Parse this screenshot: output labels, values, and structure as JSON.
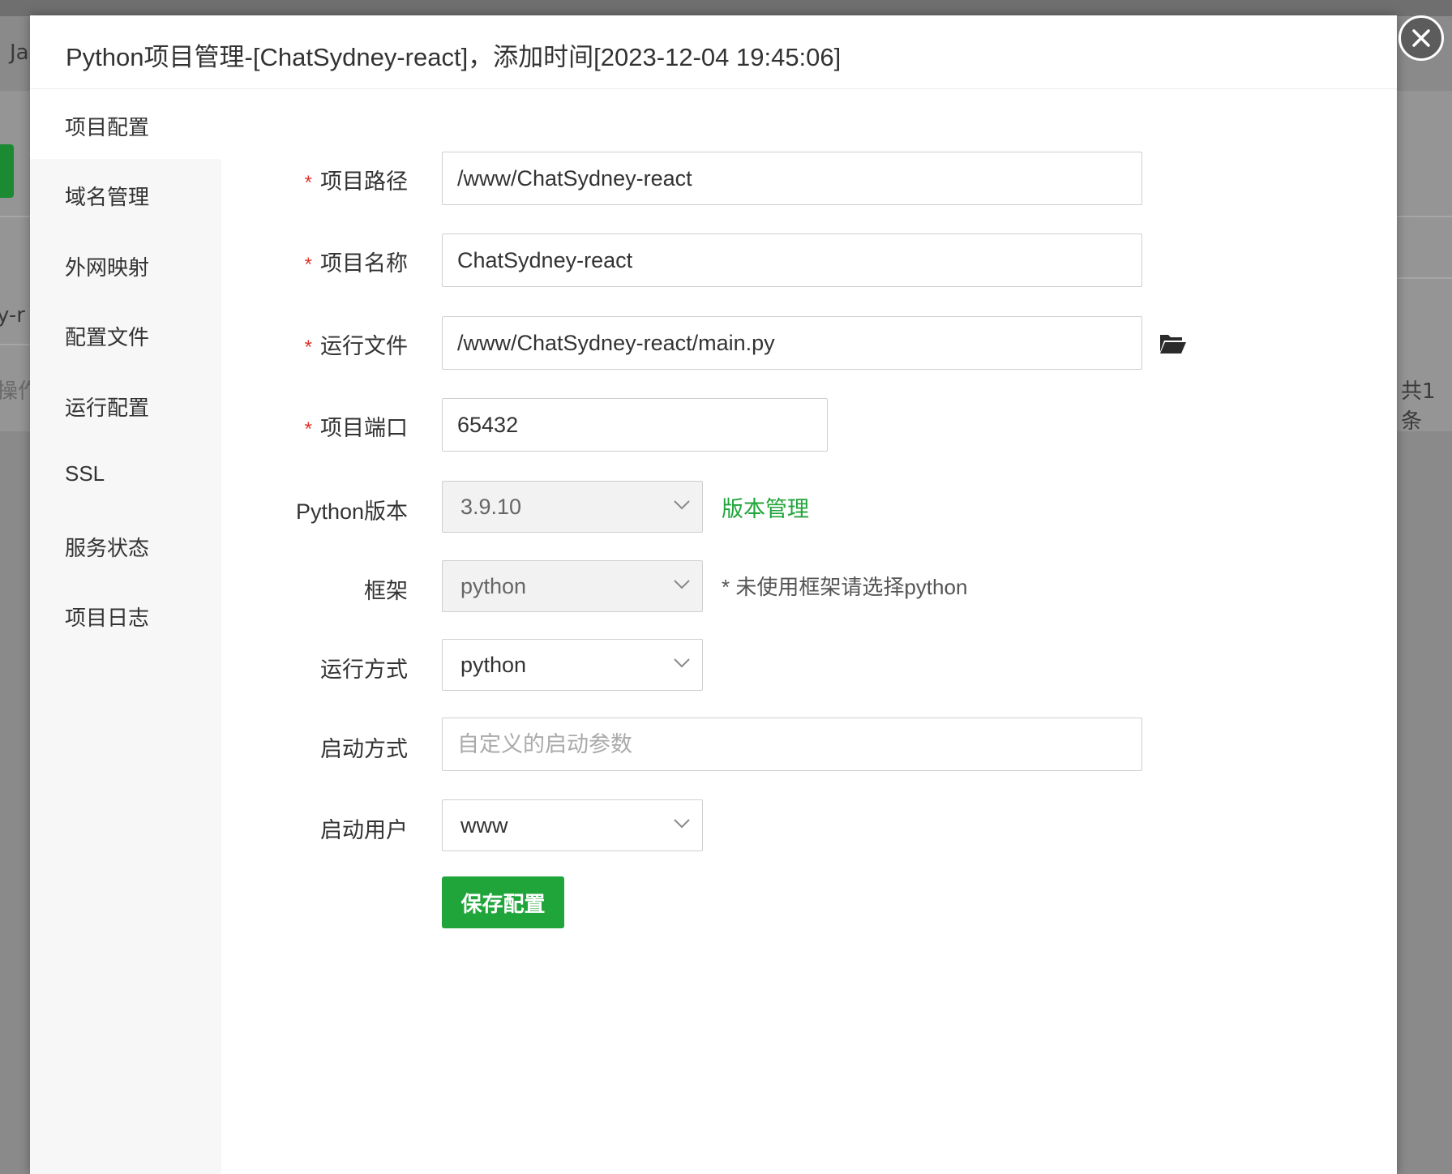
{
  "background": {
    "left_fragment_1": "Ja",
    "left_fragment_2": "y-r",
    "left_fragment_3": "操作",
    "right_fragment": "共1条"
  },
  "dialog": {
    "title": "Python项目管理-[ChatSydney-react]，添加时间[2023-12-04 19:45:06]",
    "close_icon": "close-icon"
  },
  "sidebar": {
    "items": [
      {
        "label": "项目配置"
      },
      {
        "label": "域名管理"
      },
      {
        "label": "外网映射"
      },
      {
        "label": "配置文件"
      },
      {
        "label": "运行配置"
      },
      {
        "label": "SSL"
      },
      {
        "label": "服务状态"
      },
      {
        "label": "项目日志"
      }
    ]
  },
  "form": {
    "required_mark": "*",
    "project_path": {
      "label": "项目路径",
      "value": "/www/ChatSydney-react"
    },
    "project_name": {
      "label": "项目名称",
      "value": "ChatSydney-react"
    },
    "run_file": {
      "label": "运行文件",
      "value": "/www/ChatSydney-react/main.py",
      "icon": "folder-open-icon"
    },
    "project_port": {
      "label": "项目端口",
      "value": "65432"
    },
    "python_version": {
      "label": "Python版本",
      "value": "3.9.10",
      "link": "版本管理"
    },
    "framework": {
      "label": "框架",
      "value": "python",
      "hint": "* 未使用框架请选择python"
    },
    "run_mode": {
      "label": "运行方式",
      "value": "python"
    },
    "start_mode": {
      "label": "启动方式",
      "placeholder": "自定义的启动参数"
    },
    "start_user": {
      "label": "启动用户",
      "value": "www"
    },
    "save_label": "保存配置"
  },
  "colors": {
    "accent_green": "#20a53a",
    "required_red": "#e0332b"
  }
}
